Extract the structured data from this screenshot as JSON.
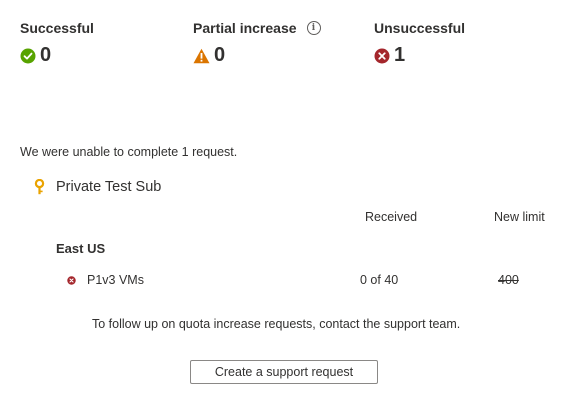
{
  "summary": {
    "successful": {
      "label": "Successful",
      "count": "0",
      "icon": "check-circle-icon",
      "color": "#57a300"
    },
    "partial": {
      "label": "Partial increase",
      "count": "0",
      "icon": "warning-icon",
      "info_icon": "info-icon",
      "color": "#db7500"
    },
    "unsuccessful": {
      "label": "Unsuccessful",
      "count": "1",
      "icon": "error-circle-icon",
      "color": "#a4262c"
    }
  },
  "message": "We were unable to complete 1 request.",
  "subscription": {
    "name": "Private Test Sub",
    "icon": "key-icon",
    "icon_color": "#eaa300"
  },
  "columns": {
    "received": "Received",
    "new_limit": "New limit"
  },
  "regions": [
    {
      "name": "East US",
      "rows": [
        {
          "status_icon": "error-circle-icon",
          "resource": "P1v3 VMs",
          "received": "0 of 40",
          "new_limit": "400"
        }
      ]
    }
  ],
  "footer": {
    "note": "To follow up on quota increase requests, contact the support team.",
    "button_label": "Create a support request"
  }
}
